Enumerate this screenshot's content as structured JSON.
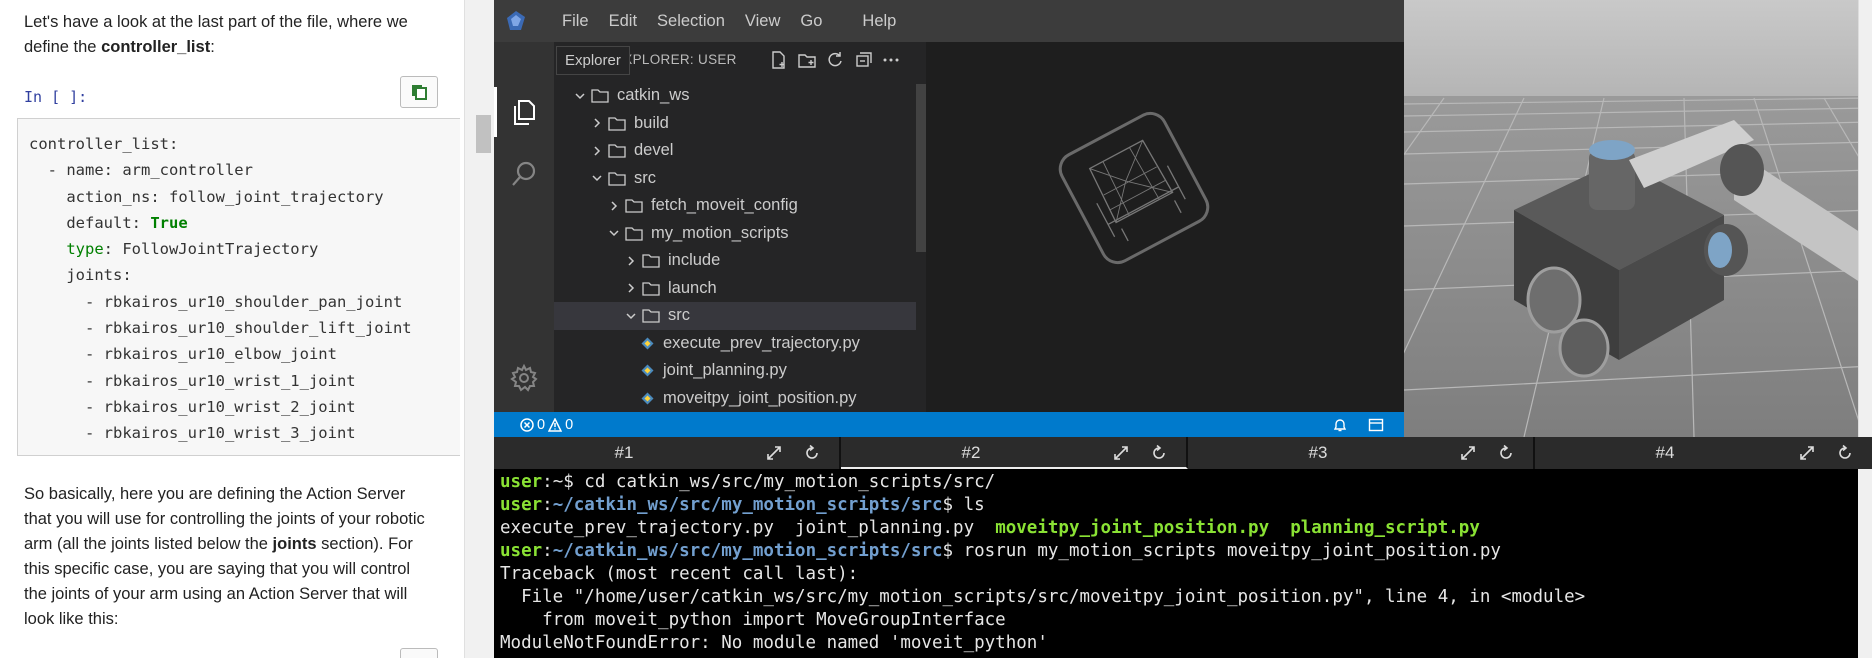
{
  "notebook": {
    "intro_text": "Let's have a look at the last part of the file, where we define the",
    "intro_bold": "controller_list",
    "intro_end": ":",
    "cell_prompt": "In [ ]:",
    "code_lines": [
      {
        "indent": "",
        "key": "controller_list:",
        "value": "",
        "vclass": ""
      },
      {
        "indent": "  - ",
        "key": "name: ",
        "value": "arm_controller",
        "vclass": ""
      },
      {
        "indent": "    ",
        "key": "action_ns: ",
        "value": "follow_joint_trajectory",
        "vclass": ""
      },
      {
        "indent": "    ",
        "key": "default: ",
        "value": "True",
        "vclass": "kw-green"
      },
      {
        "indent": "    ",
        "key": "type",
        "value": ": FollowJointTrajectory",
        "vclass": "",
        "keyclass": "kw-type"
      },
      {
        "indent": "    ",
        "key": "joints:",
        "value": "",
        "vclass": ""
      },
      {
        "indent": "      - ",
        "key": "rbkairos_ur10_shoulder_pan_joint",
        "value": "",
        "vclass": ""
      },
      {
        "indent": "      - ",
        "key": "rbkairos_ur10_shoulder_lift_joint",
        "value": "",
        "vclass": ""
      },
      {
        "indent": "      - ",
        "key": "rbkairos_ur10_elbow_joint",
        "value": "",
        "vclass": ""
      },
      {
        "indent": "      - ",
        "key": "rbkairos_ur10_wrist_1_joint",
        "value": "",
        "vclass": ""
      },
      {
        "indent": "      - ",
        "key": "rbkairos_ur10_wrist_2_joint",
        "value": "",
        "vclass": ""
      },
      {
        "indent": "      - ",
        "key": "rbkairos_ur10_wrist_3_joint",
        "value": "",
        "vclass": ""
      }
    ],
    "para2_a": "So basically, here you are defining the Action Server that you will use for controlling the joints of your robotic arm (all the joints listed below the",
    "para2_bold": "joints",
    "para2_b": "section). For this specific case, you are saying that you will control the joints of your arm using an Action Server that will look like this:"
  },
  "vscode": {
    "menu": [
      "File",
      "Edit",
      "Selection",
      "View",
      "Go",
      "Help"
    ],
    "sidebar_title": "EXPLORER: USER",
    "tooltip": "Explorer",
    "tree": [
      {
        "label": "catkin_ws",
        "depth": 1,
        "type": "folder",
        "open": true
      },
      {
        "label": "build",
        "depth": 2,
        "type": "folder",
        "open": false
      },
      {
        "label": "devel",
        "depth": 2,
        "type": "folder",
        "open": false
      },
      {
        "label": "src",
        "depth": 2,
        "type": "folder",
        "open": true
      },
      {
        "label": "fetch_moveit_config",
        "depth": 3,
        "type": "folder",
        "open": false
      },
      {
        "label": "my_motion_scripts",
        "depth": 3,
        "type": "folder",
        "open": true
      },
      {
        "label": "include",
        "depth": 4,
        "type": "folder",
        "open": false
      },
      {
        "label": "launch",
        "depth": 4,
        "type": "folder",
        "open": false
      },
      {
        "label": "src",
        "depth": 4,
        "type": "folder",
        "open": true,
        "selected": true
      },
      {
        "label": "execute_prev_trajectory.py",
        "depth": 5,
        "type": "file"
      },
      {
        "label": "joint_planning.py",
        "depth": 5,
        "type": "file"
      },
      {
        "label": "moveitpy_joint_position.py",
        "depth": 5,
        "type": "file"
      }
    ],
    "status": {
      "errors": "0",
      "warnings": "0"
    }
  },
  "terminal_tabs": [
    "#1",
    "#2",
    "#3",
    "#4"
  ],
  "terminal_lines": [
    [
      {
        "c": "t-user",
        "t": "user"
      },
      {
        "c": "",
        "t": ":~$ cd catkin_ws/src/my_motion_scripts/src/"
      }
    ],
    [
      {
        "c": "t-user",
        "t": "user"
      },
      {
        "c": "",
        "t": ":"
      },
      {
        "c": "t-path",
        "t": "~/catkin_ws/src/my_motion_scripts/src"
      },
      {
        "c": "",
        "t": "$ ls"
      }
    ],
    [
      {
        "c": "",
        "t": "execute_prev_trajectory.py  joint_planning.py  "
      },
      {
        "c": "t-exe",
        "t": "moveitpy_joint_position.py"
      },
      {
        "c": "",
        "t": "  "
      },
      {
        "c": "t-exe",
        "t": "planning_script.py"
      }
    ],
    [
      {
        "c": "t-user",
        "t": "user"
      },
      {
        "c": "",
        "t": ":"
      },
      {
        "c": "t-path",
        "t": "~/catkin_ws/src/my_motion_scripts/src"
      },
      {
        "c": "",
        "t": "$ rosrun my_motion_scripts moveitpy_joint_position.py"
      }
    ],
    [
      {
        "c": "",
        "t": "Traceback (most recent call last):"
      }
    ],
    [
      {
        "c": "",
        "t": "  File \"/home/user/catkin_ws/src/my_motion_scripts/src/moveitpy_joint_position.py\", line 4, in <module>"
      }
    ],
    [
      {
        "c": "",
        "t": "    from moveit_python import MoveGroupInterface"
      }
    ],
    [
      {
        "c": "",
        "t": "ModuleNotFoundError: No module named 'moveit_python'"
      }
    ]
  ],
  "colors": {
    "accent": "#007acc",
    "prompt_user": "#8ae234",
    "prompt_path": "#729fcf"
  }
}
